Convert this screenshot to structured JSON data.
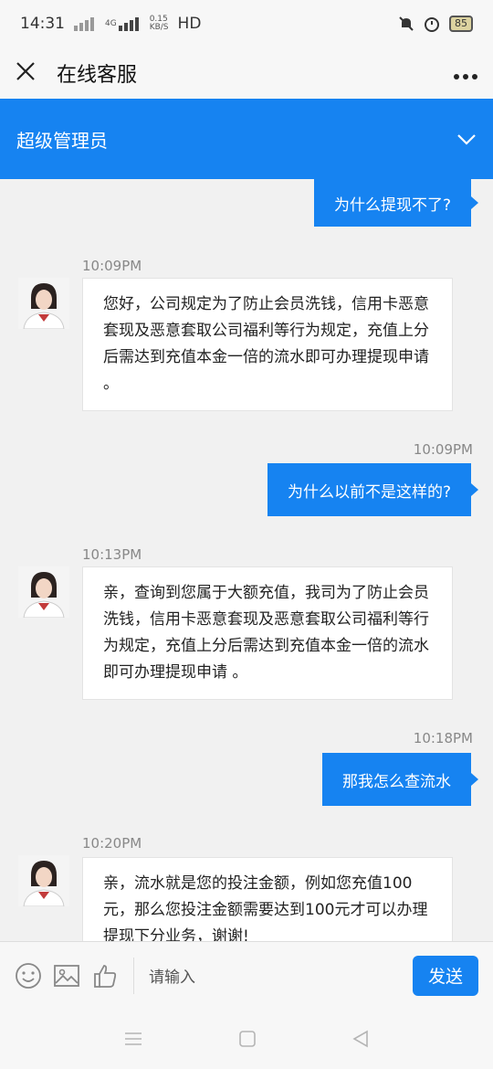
{
  "status": {
    "time": "14:31",
    "net1": "4G",
    "speed_top": "0.15",
    "speed_bottom": "KB/S",
    "hd": "HD",
    "battery": "85"
  },
  "nav": {
    "title": "在线客服"
  },
  "agent": {
    "name": "超级管理员"
  },
  "messages": [
    {
      "type": "out",
      "text": "为什么提现不了?"
    },
    {
      "type": "time",
      "text": "10:09PM"
    },
    {
      "type": "in",
      "text": "您好，公司规定为了防止会员洗钱，信用卡恶意套现及恶意套取公司福利等行为规定，充值上分后需达到充值本金一倍的流水即可办理提现申请 。"
    },
    {
      "type": "time",
      "text": "10:09PM"
    },
    {
      "type": "out",
      "text": "为什么以前不是这样的?"
    },
    {
      "type": "time",
      "text": "10:13PM"
    },
    {
      "type": "in",
      "text": "亲，查询到您属于大额充值，我司为了防止会员洗钱，信用卡恶意套现及恶意套取公司福利等行为规定，充值上分后需达到充值本金一倍的流水即可办理提现申请 。"
    },
    {
      "type": "time",
      "text": "10:18PM"
    },
    {
      "type": "out",
      "text": "那我怎么查流水"
    },
    {
      "type": "time",
      "text": "10:20PM"
    },
    {
      "type": "in",
      "text": "亲，流水就是您的投注金额，例如您充值100元，那么您投注金额需要达到100元才可以办理提现下分业务，谢谢!"
    }
  ],
  "composer": {
    "placeholder": "请输入",
    "send_label": "发送"
  },
  "colors": {
    "accent": "#1683f1"
  }
}
